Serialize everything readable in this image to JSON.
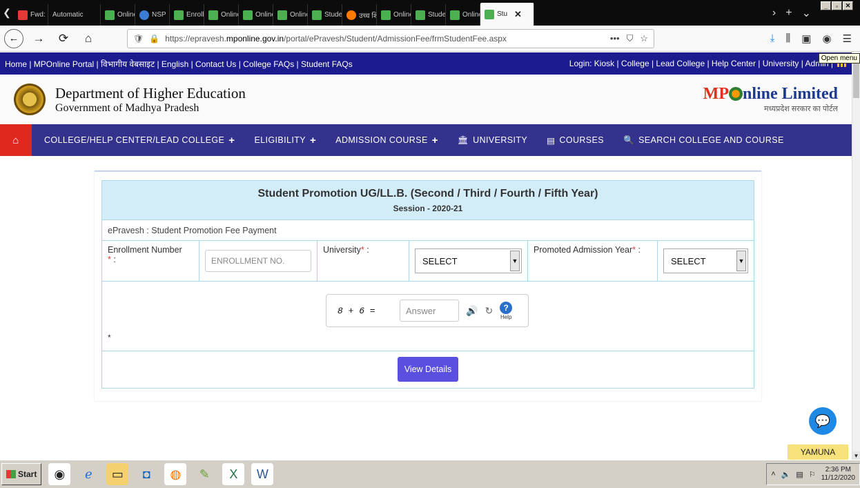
{
  "browser": {
    "tabs": [
      {
        "label": "Fwd: U",
        "icon": "gmail-icon"
      },
      {
        "label": "Automatic",
        "icon": "page-icon"
      },
      {
        "label": "Online",
        "icon": "online-icon"
      },
      {
        "label": "NSP",
        "icon": "nsp-icon"
      },
      {
        "label": "Enrolln",
        "icon": "online-icon"
      },
      {
        "label": "Online",
        "icon": "online-icon"
      },
      {
        "label": "Online",
        "icon": "online-icon"
      },
      {
        "label": "Online",
        "icon": "online-icon"
      },
      {
        "label": "Studen",
        "icon": "online-icon"
      },
      {
        "label": "उच्च शि",
        "icon": "orange-icon"
      },
      {
        "label": "Online",
        "icon": "online-icon"
      },
      {
        "label": "Studen",
        "icon": "online-icon"
      },
      {
        "label": "Online",
        "icon": "online-icon"
      },
      {
        "label": "Stu",
        "icon": "online-icon",
        "active": true
      }
    ],
    "url_prefix": "https://epravesh.",
    "url_domain": "mponline.gov.in",
    "url_path": "/portal/ePravesh/Student/AdmissionFee/frmStudentFee.aspx",
    "tooltip": "Open menu"
  },
  "site": {
    "toplinks": "Home | MPOnline Portal | विभागीय वेबसाइट | English | Contact Us | College FAQs | Student FAQs",
    "loginlinks": "Login: Kiosk | College | Lead College | Help Center | University | Admin |",
    "dept_line1": "Department of Higher Education",
    "dept_line2": "Government of Madhya Pradesh",
    "logo_mp": "MP",
    "logo_rest": "nline Limited",
    "logo_tag": "मध्यप्रदेश सरकार का पोर्टल",
    "nav": [
      {
        "label": "COLLEGE/HELP CENTER/LEAD COLLEGE",
        "suffix": "+"
      },
      {
        "label": "ELIGIBILITY",
        "suffix": "+"
      },
      {
        "label": "ADMISSION COURSE",
        "suffix": "+"
      },
      {
        "label": "UNIVERSITY",
        "prefix": "🏛"
      },
      {
        "label": "COURSES",
        "prefix": "▤"
      },
      {
        "label": "SEARCH COLLEGE AND COURSE",
        "prefix": "🔍"
      }
    ]
  },
  "form": {
    "title": "Student Promotion UG/LL.B. (Second / Third / Fourth / Fifth Year)",
    "session": "Session - 2020-21",
    "subtitle": "ePravesh : Student Promotion Fee Payment",
    "enroll_label": "Enrollment Number",
    "enroll_placeholder": "ENROLLMENT NO.",
    "university_label": "University",
    "university_value": "SELECT",
    "promoted_label": "Promoted Admission Year",
    "promoted_value": "SELECT",
    "captcha_question": "8 + 6 =",
    "captcha_placeholder": "Answer",
    "help_label": "Help",
    "required_mark": "*",
    "button": "View Details"
  },
  "widgets": {
    "yamuna": "YAMUNA"
  },
  "taskbar": {
    "start": "Start",
    "time": "2:36 PM",
    "date": "11/12/2020"
  }
}
